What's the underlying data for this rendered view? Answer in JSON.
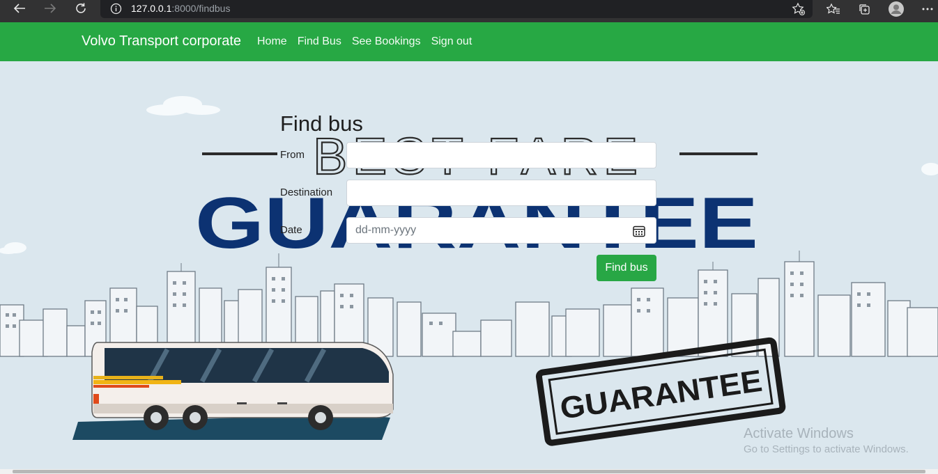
{
  "browser": {
    "url_host": "127.0.0.1",
    "url_rest": ":8000/findbus"
  },
  "navbar": {
    "brand": "Volvo Transport corporate",
    "links": [
      "Home",
      "Find Bus",
      "See Bookings",
      "Sign out"
    ],
    "color": "#27a844"
  },
  "background": {
    "headline_top": "BEST FARE",
    "headline_main": "GUARANTEE",
    "stamp_text": "GUARANTEE"
  },
  "form": {
    "title": "Find bus",
    "from_label": "From",
    "from_value": "",
    "destination_label": "Destination",
    "destination_value": "",
    "date_label": "Date",
    "date_placeholder": "dd-mm-yyyy",
    "submit_label": "Find bus",
    "accent": "#28a745"
  },
  "watermark": {
    "line1": "Activate Windows",
    "line2": "Go to Settings to activate Windows."
  }
}
